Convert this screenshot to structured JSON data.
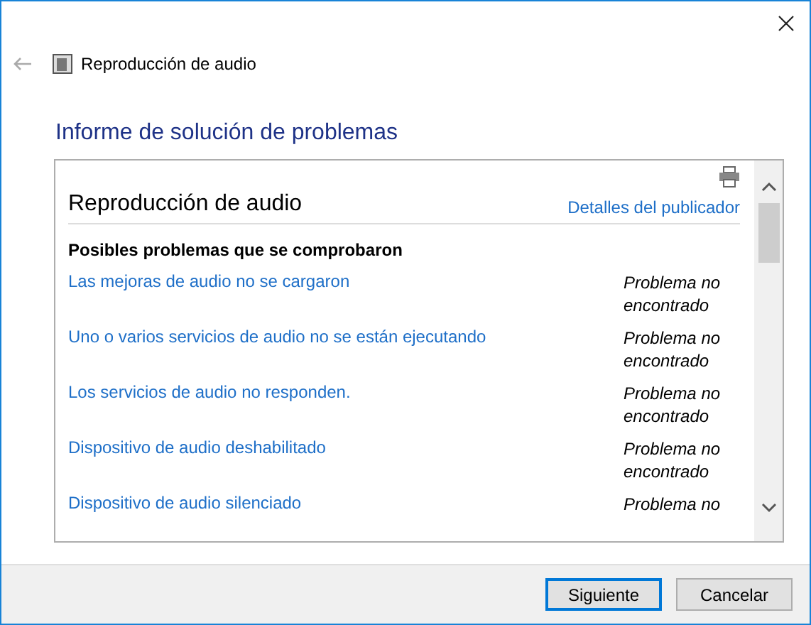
{
  "window": {
    "title": "Reproducción de audio"
  },
  "heading": "Informe de solución de problemas",
  "report": {
    "title": "Reproducción de audio",
    "publisher_link": "Detalles del publicador",
    "section": "Posibles problemas que se comprobaron",
    "rows": [
      {
        "problem": "Las mejoras de audio no se cargaron",
        "status": "Problema no encontrado"
      },
      {
        "problem": "Uno o varios servicios de audio no se están ejecutando",
        "status": "Problema no encontrado"
      },
      {
        "problem": "Los servicios de audio no responden.",
        "status": "Problema no encontrado"
      },
      {
        "problem": "Dispositivo de audio deshabilitado",
        "status": "Problema no encontrado"
      },
      {
        "problem": "Dispositivo de audio silenciado",
        "status": "Problema no"
      }
    ]
  },
  "buttons": [
    {
      "label": "Siguiente",
      "default": true
    },
    {
      "label": "Cancelar",
      "default": false
    }
  ]
}
